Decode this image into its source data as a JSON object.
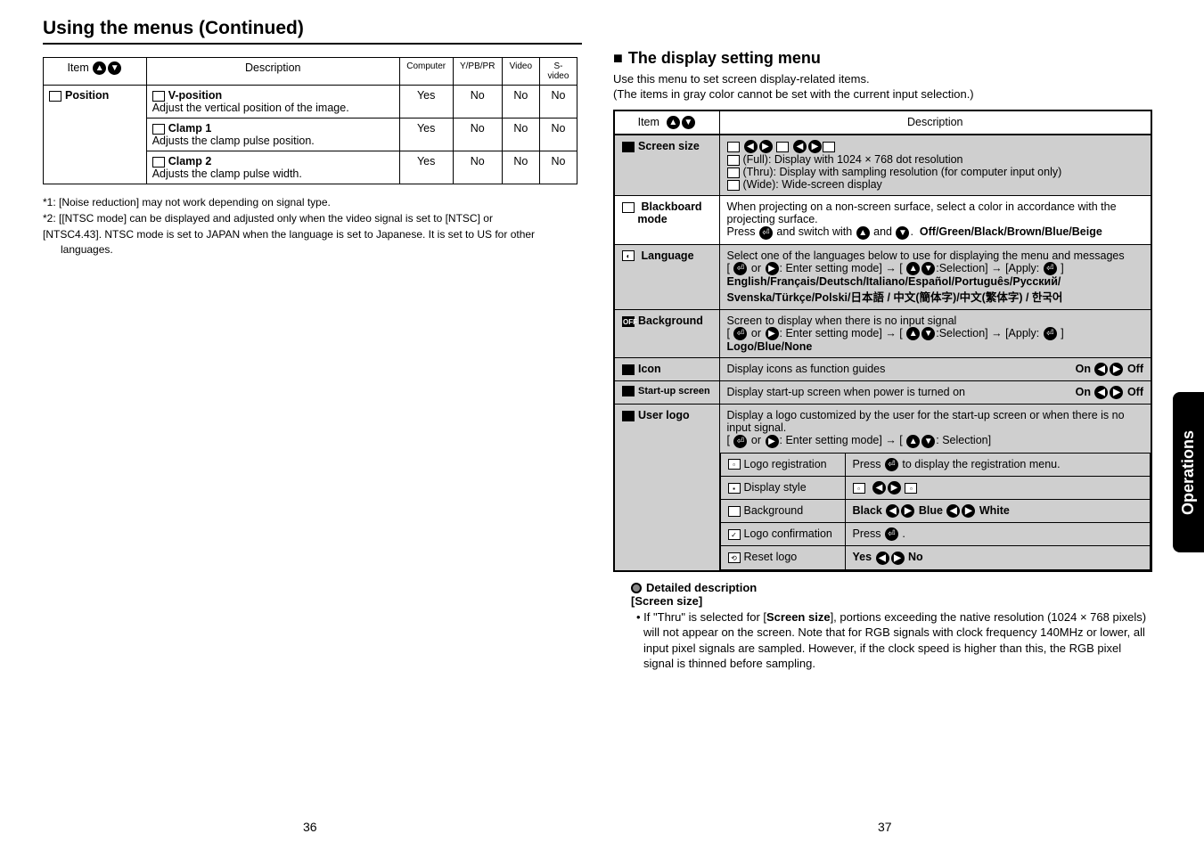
{
  "heading_left": "Using the menus (Continued)",
  "left_table": {
    "headers": {
      "item": "Item",
      "desc": "Description",
      "c1": "Computer",
      "c2": "Y/PB/PR",
      "c3": "Video",
      "c4": "S-video"
    },
    "item_label": "Position",
    "rows": [
      {
        "title": "V-position",
        "body": "Adjust the vertical position of the image.",
        "v": [
          "Yes",
          "No",
          "No",
          "No"
        ]
      },
      {
        "title": "Clamp 1",
        "body": "Adjusts the clamp pulse position.",
        "v": [
          "Yes",
          "No",
          "No",
          "No"
        ]
      },
      {
        "title": "Clamp 2",
        "body": "Adjusts the clamp pulse width.",
        "v": [
          "Yes",
          "No",
          "No",
          "No"
        ]
      }
    ]
  },
  "footnotes": {
    "f1": "*1: [Noise reduction] may not work depending on signal type.",
    "f2a": "*2: [[NTSC mode] can be displayed and adjusted only when the video signal is set to [NTSC] or",
    "f2b": "[NTSC4.43]. NTSC mode is set to JAPAN when the language is set to Japanese. It is set to US for other languages."
  },
  "heading_right": "The display setting menu",
  "right_intro1": "Use this menu to set screen display-related items.",
  "right_intro2": "(The items in gray color cannot be set with the current input selection.)",
  "right_headers": {
    "item": "Item",
    "desc": "Description"
  },
  "screen_size": {
    "label": "Screen size",
    "full": "(Full):  Display with 1024 × 768 dot resolution",
    "thru": "(Thru): Display with sampling resolution (for computer input only)",
    "wide": "(Wide):  Wide-screen display"
  },
  "blackboard": {
    "label1": "Blackboard",
    "label2": "mode",
    "l1": "When projecting on a non-screen surface, select a color in accordance with the projecting surface.",
    "l2": "Press ⏎ and switch with ▲ and ▼.  Off/Green/Black/Brown/Blue/Beige"
  },
  "language": {
    "label": "Language",
    "l1": "Select one of the languages below to use for displaying the menu and messages",
    "l2": "[ ⏎ or ▶ : Enter setting mode] → [ ▲ ▼ :Selection] → [Apply: ⏎ ]",
    "l3": "English/Français/Deutsch/Italiano/Español/Português/Русский/",
    "l4": "Svenska/Türkçe/Polski/日本語 / 中文(簡体字)/中文(繁体字) / 한국어"
  },
  "background": {
    "label": "Background",
    "l1": "Screen to display when there is no input signal",
    "l2": "[ ⏎ or ▶ : Enter setting mode] → [ ▲ ▼ :Selection] → [Apply: ⏎ ]",
    "l3": "Logo/Blue/None"
  },
  "icon": {
    "label": "Icon",
    "text": "Display icons as function guides",
    "onoff": "On ◀ ▶ Off"
  },
  "startup": {
    "label": "Start-up screen",
    "text": "Display start-up screen when power is turned on",
    "onoff": "On ◀ ▶ Off"
  },
  "userlogo": {
    "label": "User logo",
    "l1": "Display a logo customized by the user for the start-up screen or when there is no input signal.",
    "l2": "[ ⏎ or ▶ : Enter setting mode] → [ ▲ ▼ : Selection]",
    "rows": {
      "r1a": "Logo registration",
      "r1b": "Press ⏎ to display the registration menu.",
      "r2a": "Display style",
      "r2b": "▫ ◀ ▶ ▫",
      "r3a": "Background",
      "r3b": "Black ◀ ▶ Blue ◀ ▶ White",
      "r4a": "Logo confirmation",
      "r4b": "Press ⏎ .",
      "r5a": "Reset logo",
      "r5b": "Yes ◀ ▶ No"
    }
  },
  "detail": {
    "title": "Detailed description",
    "sub": "[Screen size]",
    "body": "If \"Thru\" is selected for [Screen size], portions exceeding the native resolution (1024 × 768 pixels) will not appear on the screen. Note that for RGB signals with clock frequency 140MHz or lower, all input pixel signals are sampled. However, if the clock speed is higher than this, the RGB pixel signal is thinned before sampling."
  },
  "page_left_num": "36",
  "page_right_num": "37",
  "side_tab": "Operations"
}
